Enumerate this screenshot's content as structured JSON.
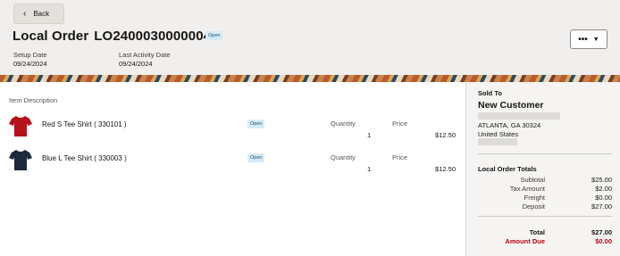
{
  "header": {
    "back_label": "Back",
    "title_prefix": "Local Order",
    "order_number": "LO2400030000004",
    "status": "Open",
    "more_label": "•••",
    "setup_date_label": "Setup Date",
    "setup_date": "09/24/2024",
    "last_activity_label": "Last Activity Date",
    "last_activity": "09/24/2024"
  },
  "items": {
    "column_header": "Item Description",
    "qty_label": "Quantity",
    "price_label": "Price",
    "rows": [
      {
        "name": "Red S Tee Shirt ( 330101 )",
        "status": "Open",
        "quantity": "1",
        "price": "$12.50",
        "color": "#b5121b"
      },
      {
        "name": "Blue L Tee Shirt ( 330003 )",
        "status": "Open",
        "quantity": "1",
        "price": "$12.50",
        "color": "#1c2a3a"
      }
    ]
  },
  "sold_to": {
    "label": "Sold To",
    "customer": "New Customer",
    "city_line": "ATLANTA, GA 30324",
    "country": "United States"
  },
  "totals": {
    "title": "Local Order Totals",
    "subtotal_label": "Subtotal",
    "subtotal": "$25.00",
    "tax_label": "Tax Amount",
    "tax": "$2.00",
    "freight_label": "Freight",
    "freight": "$0.00",
    "deposit_label": "Deposit",
    "deposit": "$27.00",
    "total_label": "Total",
    "total": "$27.00",
    "due_label": "Amount Due",
    "due": "$0.00"
  }
}
